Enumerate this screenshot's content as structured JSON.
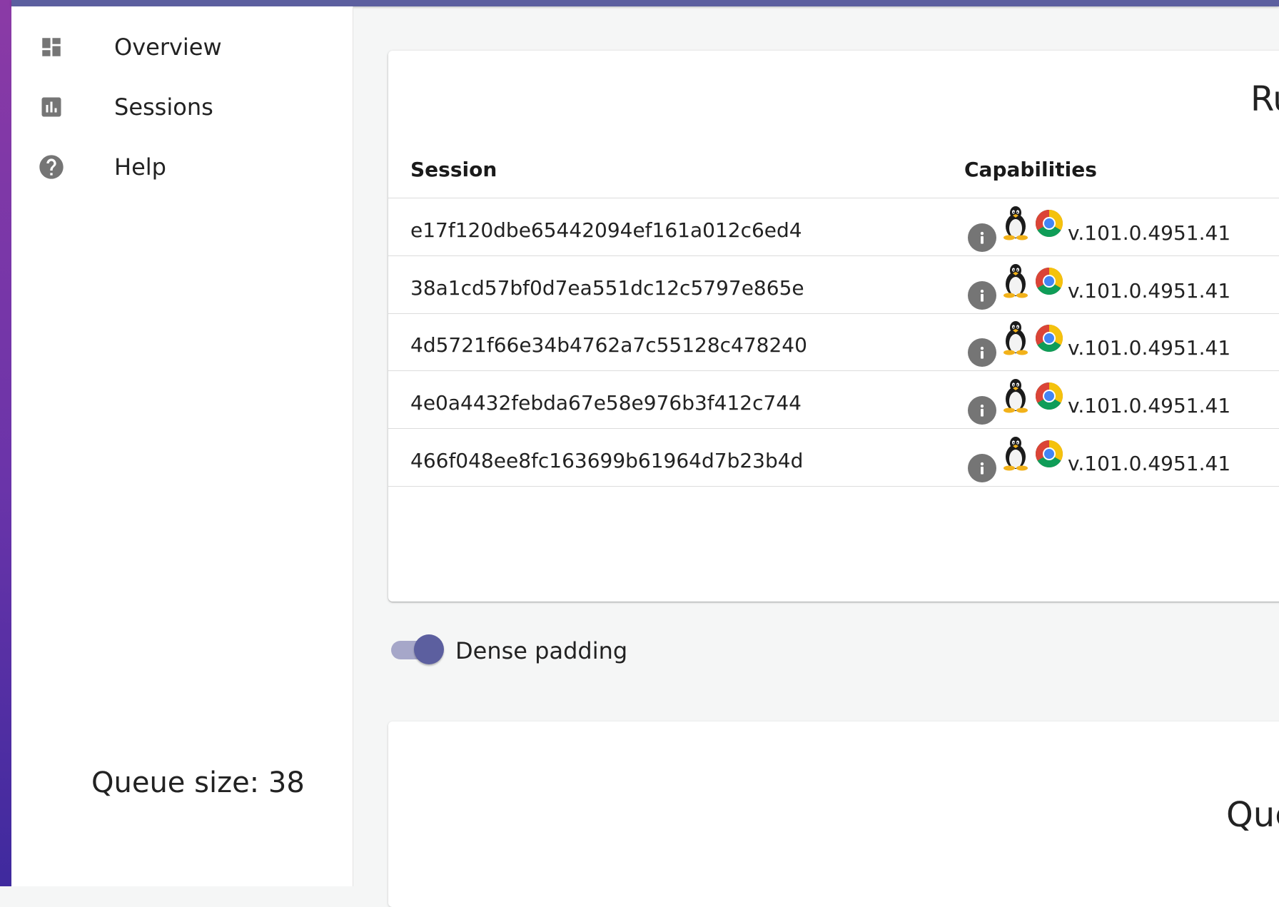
{
  "sidebar": {
    "items": [
      {
        "label": "Overview",
        "icon": "dashboard-icon"
      },
      {
        "label": "Sessions",
        "icon": "bar-chart-icon"
      },
      {
        "label": "Help",
        "icon": "help-icon"
      }
    ],
    "queue_size": "Queue size: 38"
  },
  "running_card": {
    "title": "Ru",
    "columns": [
      "Session",
      "Capabilities"
    ],
    "rows": [
      {
        "session": "e17f120dbe65442094ef161a012c6ed4",
        "platform": "linux-icon",
        "browser": "chrome-icon",
        "version": "v.101.0.4951.41"
      },
      {
        "session": "38a1cd57bf0d7ea551dc12c5797e865e",
        "platform": "linux-icon",
        "browser": "chrome-icon",
        "version": "v.101.0.4951.41"
      },
      {
        "session": "4d5721f66e34b4762a7c55128c478240",
        "platform": "linux-icon",
        "browser": "chrome-icon",
        "version": "v.101.0.4951.41"
      },
      {
        "session": "4e0a4432febda67e58e976b3f412c744",
        "platform": "linux-icon",
        "browser": "chrome-icon",
        "version": "v.101.0.4951.41"
      },
      {
        "session": "466f048ee8fc163699b61964d7b23b4d",
        "platform": "linux-icon",
        "browser": "chrome-icon",
        "version": "v.101.0.4951.41"
      }
    ]
  },
  "dense_padding": {
    "label": "Dense padding",
    "checked": true
  },
  "queue_card": {
    "title": "Que"
  },
  "colors": {
    "accent": "#5c5f9f",
    "accent_light": "#a6a7c9",
    "icon_grey": "#757575",
    "background": "#f5f6f6"
  }
}
